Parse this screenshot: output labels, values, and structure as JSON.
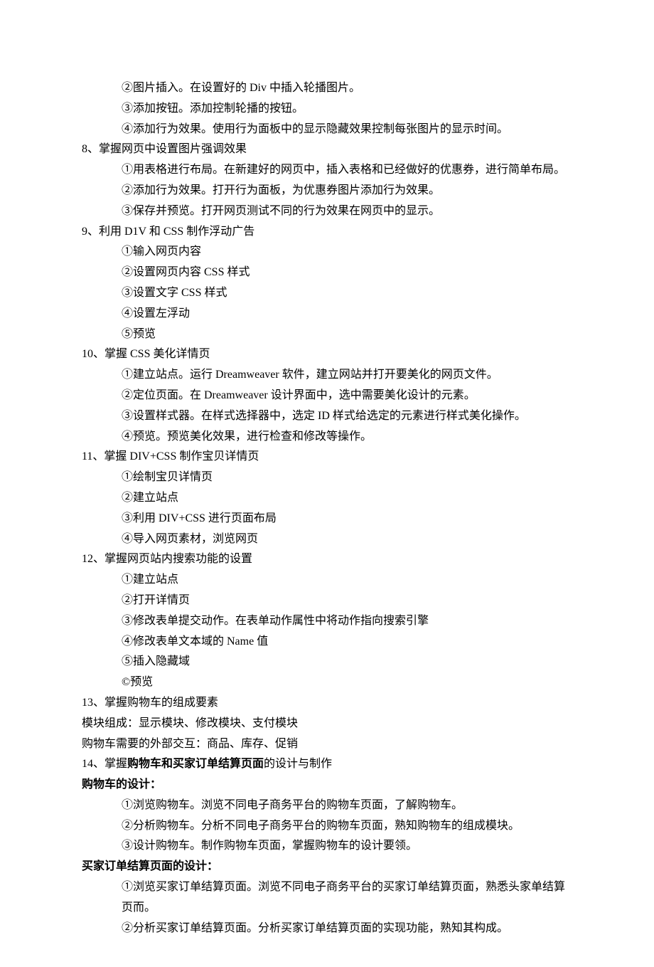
{
  "lines": [
    {
      "indent": 1,
      "bold": false,
      "text": "②图片插入。在设置好的 Div 中插入轮播图片。"
    },
    {
      "indent": 1,
      "bold": false,
      "text": "③添加按钮。添加控制轮播的按钮。"
    },
    {
      "indent": 1,
      "bold": false,
      "text": "④添加行为效果。使用行为面板中的显示隐藏效果控制每张图片的显示时间。"
    },
    {
      "indent": 0,
      "bold": false,
      "text": "8、掌握网页中设置图片强调效果"
    },
    {
      "indent": 1,
      "bold": false,
      "text": "①用表格进行布局。在新建好的网页中，插入表格和已经做好的优惠券，进行简单布局。"
    },
    {
      "indent": 1,
      "bold": false,
      "text": "②添加行为效果。打开行为面板，为优惠券图片添加行为效果。"
    },
    {
      "indent": 1,
      "bold": false,
      "text": "③保存并预览。打开网页测试不同的行为效果在网页中的显示。"
    },
    {
      "indent": 0,
      "bold": false,
      "text": "9、利用 D1V 和 CSS 制作浮动广告"
    },
    {
      "indent": 1,
      "bold": false,
      "text": "①输入网页内容"
    },
    {
      "indent": 1,
      "bold": false,
      "text": "②设置网页内容 CSS 样式"
    },
    {
      "indent": 1,
      "bold": false,
      "text": "③设置文字 CSS 样式"
    },
    {
      "indent": 1,
      "bold": false,
      "text": "④设置左浮动"
    },
    {
      "indent": 1,
      "bold": false,
      "text": "⑤预览"
    },
    {
      "indent": 0,
      "bold": false,
      "text": "10、掌握 CSS 美化详情页"
    },
    {
      "indent": 1,
      "bold": false,
      "text": "①建立站点。运行 Dreamweaver 软件，建立网站并打开要美化的网页文件。"
    },
    {
      "indent": 1,
      "bold": false,
      "text": "②定位页面。在 Dreamweaver 设计界面中，选中需要美化设计的元素。"
    },
    {
      "indent": 1,
      "bold": false,
      "text": "③设置样式器。在样式选择器中，选定 ID 样式给选定的元素进行样式美化操作。"
    },
    {
      "indent": 1,
      "bold": false,
      "text": "④预览。预览美化效果，进行检查和修改等操作。"
    },
    {
      "indent": 0,
      "bold": false,
      "text": "11、掌握 DIV+CSS 制作宝贝详情页"
    },
    {
      "indent": 1,
      "bold": false,
      "text": "①绘制宝贝详情页"
    },
    {
      "indent": 1,
      "bold": false,
      "text": "②建立站点"
    },
    {
      "indent": 1,
      "bold": false,
      "text": "③利用 DIV+CSS 进行页面布局"
    },
    {
      "indent": 1,
      "bold": false,
      "text": "④导入网页素材，浏览网页"
    },
    {
      "indent": 0,
      "bold": false,
      "text": "12、掌握网页站内搜索功能的设置"
    },
    {
      "indent": 1,
      "bold": false,
      "text": "①建立站点"
    },
    {
      "indent": 1,
      "bold": false,
      "text": "②打开详情页"
    },
    {
      "indent": 1,
      "bold": false,
      "text": "③修改表单提交动作。在表单动作属性中将动作指向搜索引擎"
    },
    {
      "indent": 1,
      "bold": false,
      "text": "④修改表单文本域的 Name 值"
    },
    {
      "indent": 1,
      "bold": false,
      "text": "⑤插入隐藏域"
    },
    {
      "indent": 1,
      "bold": false,
      "text": "©预览"
    },
    {
      "indent": 0,
      "bold": false,
      "text": "13、掌握购物车的组成要素"
    },
    {
      "indent": 0,
      "bold": false,
      "text": "模块组成：显示模块、修改模块、支付模块"
    },
    {
      "indent": 0,
      "bold": false,
      "text": "购物车需要的外部交互：商品、库存、促销"
    },
    {
      "indent": 0,
      "bold": false,
      "text": "14、掌握购物车和买家订单结算页面的设计与制作",
      "boldPart": "购物车和买家订单结算页面"
    },
    {
      "indent": 0,
      "bold": true,
      "text": "购物车的设计："
    },
    {
      "indent": 1,
      "bold": false,
      "text": "①浏览购物车。浏览不同电子商务平台的购物车页面，了解购物车。"
    },
    {
      "indent": 1,
      "bold": false,
      "text": "②分析购物车。分析不同电子商务平台的购物车页面，熟知购物车的组成模块。"
    },
    {
      "indent": 1,
      "bold": false,
      "text": "③设计购物车。制作购物车页面，掌握购物车的设计要领。"
    },
    {
      "indent": 0,
      "bold": true,
      "text": "买家订单结算页面的设计："
    },
    {
      "indent": 1,
      "bold": false,
      "text": "①浏览买家订单结算页面。浏览不同电子商务平台的买家订单结算页面，熟悉头家单结算页而。"
    },
    {
      "indent": 1,
      "bold": false,
      "text": "②分析买家订单结算页面。分析买家订单结算页面的实现功能，熟知其构成。"
    }
  ]
}
